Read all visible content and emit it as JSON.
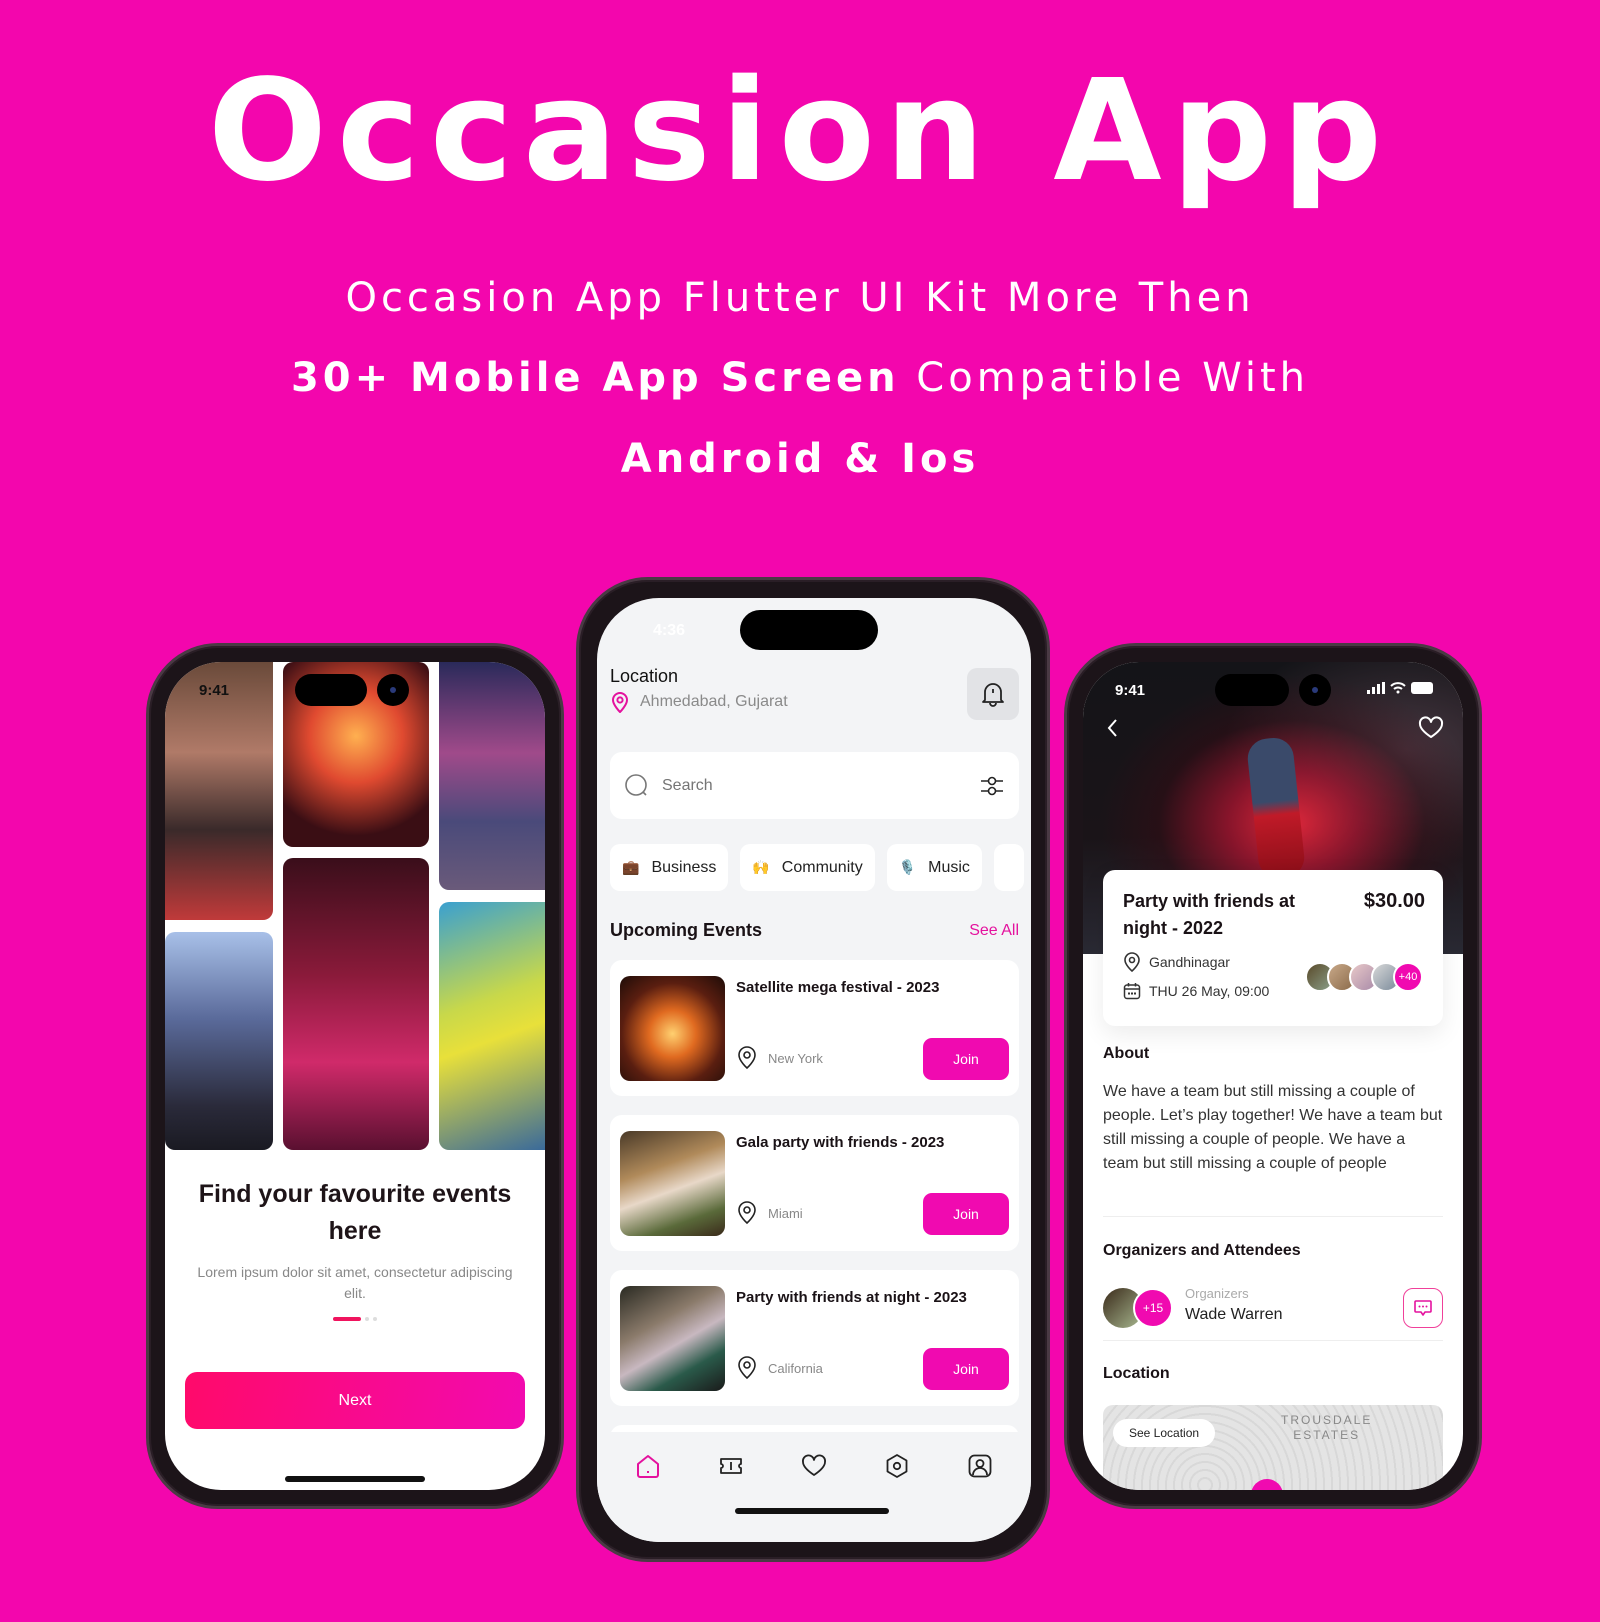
{
  "hero": {
    "title": "Occasion App",
    "line1": "Occasion App Flutter UI Kit More Then",
    "line2_bold": "30+ Mobile App Screen",
    "line2_rest": " Compatible With",
    "line3": "Android & Ios"
  },
  "colors": {
    "background": "#f306ad",
    "accent": "#f00ab0",
    "next_gradient_start": "#ff0a6a",
    "next_gradient_end": "#f20ab0"
  },
  "onboarding": {
    "status_time": "9:41",
    "title": "Find your favourite events here",
    "description": "Lorem ipsum dolor sit amet, consectetur adipiscing elit.",
    "page_indicator": {
      "current": 1,
      "total": 3
    },
    "next_label": "Next"
  },
  "home": {
    "status_time": "4:36",
    "location_label": "Location",
    "location_value": "Ahmedabad, Gujarat",
    "search_placeholder": "Search",
    "categories": [
      {
        "emoji": "💼",
        "label": "Business"
      },
      {
        "emoji": "🙌",
        "label": "Community"
      },
      {
        "emoji": "🎙️",
        "label": "Music"
      }
    ],
    "section_title": "Upcoming Events",
    "see_all": "See All",
    "events": [
      {
        "title": "Satellite mega festival - 2023",
        "location": "New York",
        "join_label": "Join"
      },
      {
        "title": "Gala party with friends - 2023",
        "location": "Miami",
        "join_label": "Join"
      },
      {
        "title": "Party with friends at night - 2023",
        "location": "California",
        "join_label": "Join"
      }
    ],
    "nav": [
      "home-icon",
      "ticket-icon",
      "heart-icon",
      "settings-hex-icon",
      "profile-icon"
    ]
  },
  "detail": {
    "status_time": "9:41",
    "title": "Party with friends at night - 2022",
    "price": "$30.00",
    "location": "Gandhinagar",
    "datetime": "THU 26 May, 09:00",
    "attendees_more": "+40",
    "about_title": "About",
    "about_text": "We have a team but still missing a couple of people. Let’s play together! We have a team but still missing a couple of people. We have a team but still missing a couple of people",
    "organizers_title": "Organizers and Attendees",
    "organizers_more": "+15",
    "organizer_label": "Organizers",
    "organizer_name": "Wade Warren",
    "location_title": "Location",
    "see_location": "See Location",
    "map_label_1": "TROUSDALE",
    "map_label_2": "ESTATES"
  }
}
